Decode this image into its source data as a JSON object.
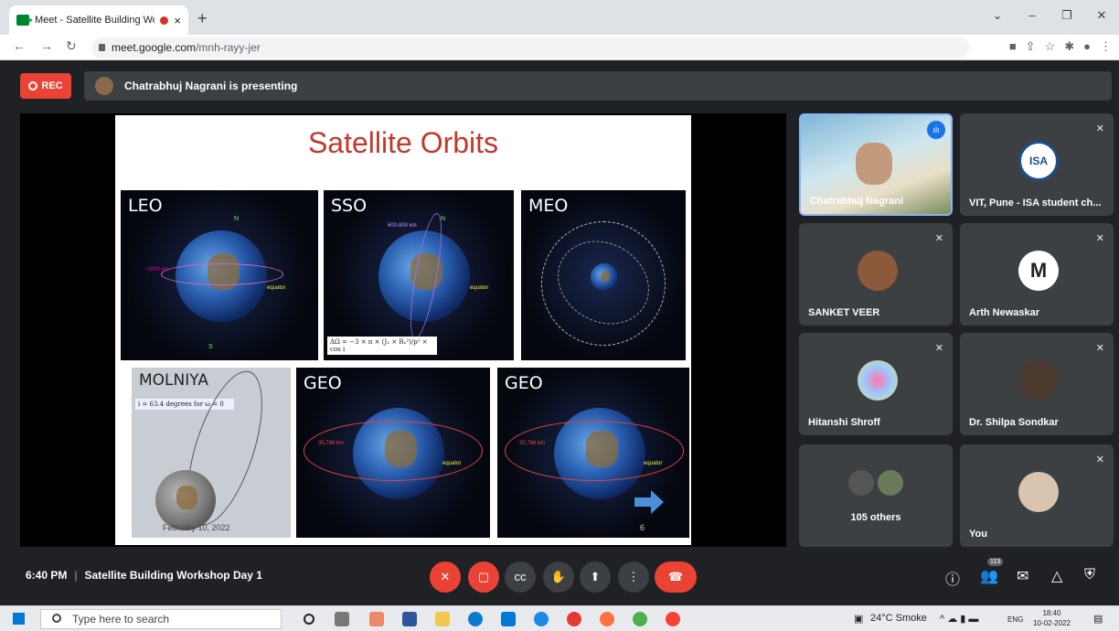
{
  "browser": {
    "tab_title": "Meet - Satellite Building Wo",
    "tab_close": "×",
    "new_tab": "+",
    "url_host": "meet.google.com",
    "url_path": "/mnh-rayy-jer"
  },
  "meet": {
    "rec_label": "REC",
    "presenting_text": "Chatrabhuj Nagrani is presenting",
    "meeting_time": "6:40 PM",
    "meeting_title": "Satellite Building Workshop Day 1",
    "people_badge": "113"
  },
  "slide": {
    "title": "Satellite Orbits",
    "panels": {
      "leo": "LEO",
      "sso": "SSO",
      "meo": "MEO",
      "molniya": "MOLNIYA",
      "geo1": "GEO",
      "geo2": "GEO"
    },
    "leo_alt": "~1000 km",
    "sso_alt": "600-800 km",
    "equator": "equator",
    "geo_alt": "35,786 km",
    "north": "N",
    "south": "S",
    "sso_formula": "ΔΩ = −3 × π × (J₂ × Rₑ²)/p² × cos i",
    "molniya_formula": "i = 63.4 degrees for ω = 0",
    "molniya_date": "February 10, 2022",
    "slide_number": "6"
  },
  "participants": [
    {
      "name": "Chatrabhuj Nagrani"
    },
    {
      "name": "VIT, Pune - ISA student ch...",
      "avatar_text": "ISA"
    },
    {
      "name": "SANKET VEER"
    },
    {
      "name": "Arth Newaskar",
      "avatar_text": "M"
    },
    {
      "name": "Hitanshi Shroff"
    },
    {
      "name": "Dr. Shilpa Sondkar"
    },
    {
      "name": "105 others"
    },
    {
      "name": "You"
    }
  ],
  "taskbar": {
    "search_placeholder": "Type here to search",
    "weather": "24°C  Smoke",
    "lang": "ENG",
    "time": "18:40",
    "date": "10-02-2022"
  },
  "colors": {
    "meet_bg": "#202124",
    "tile_bg": "#3c4043",
    "red": "#ea4335",
    "slide_title": "#c0392b",
    "active_border": "#8ab4f8"
  }
}
